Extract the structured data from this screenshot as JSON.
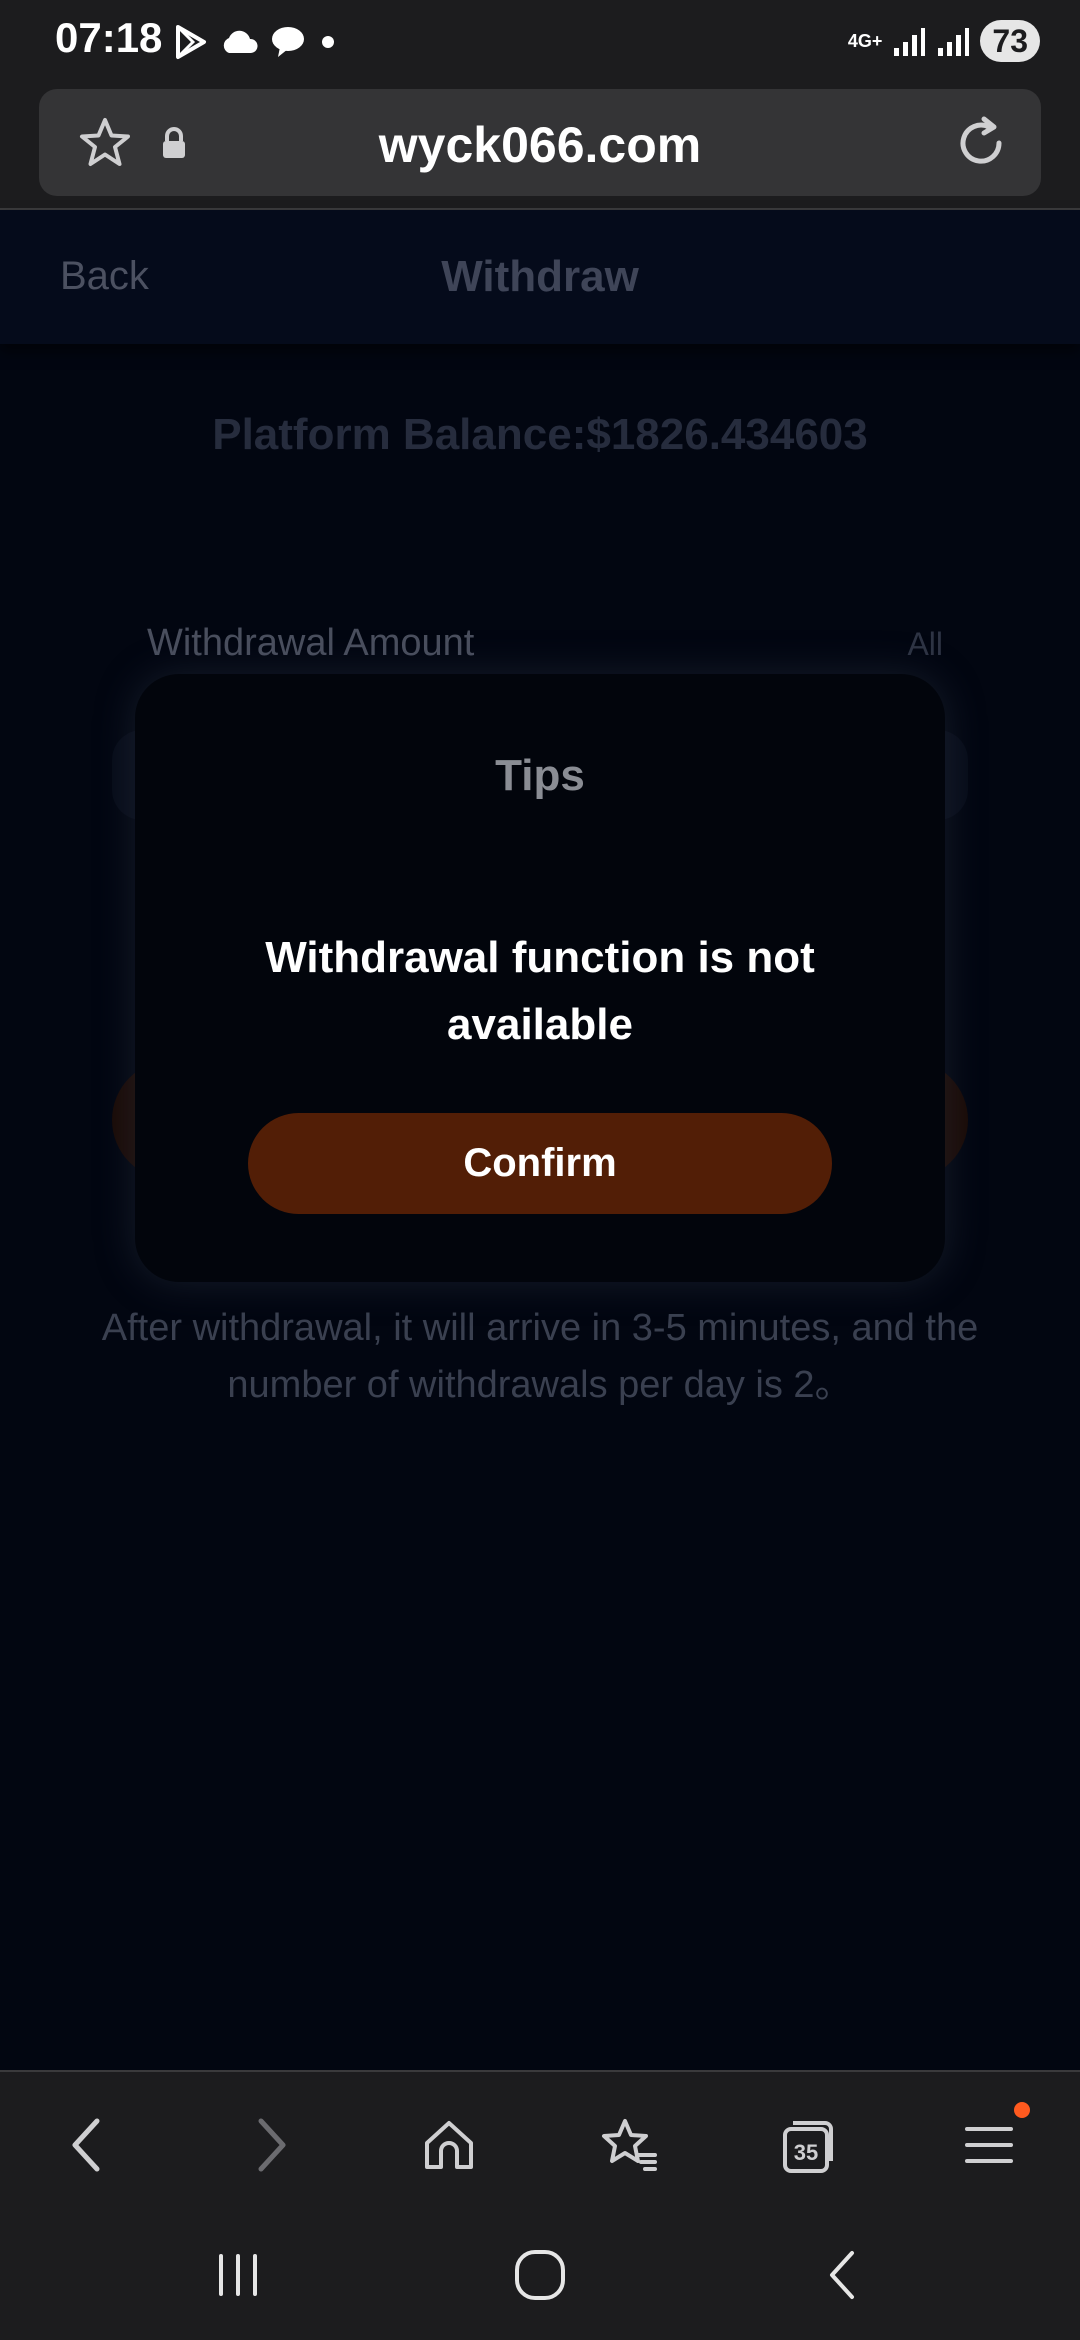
{
  "status_bar": {
    "time": "07:18",
    "network": "4G+",
    "battery": "73",
    "left_icons": [
      "play-store-icon",
      "cloud-icon",
      "chat-bubble-icon",
      "dot-icon"
    ]
  },
  "browser": {
    "url": "wyck066.com",
    "tab_count": "35"
  },
  "page": {
    "back_label": "Back",
    "title": "Withdraw",
    "balance_text": "Platform Balance:$1826.434603",
    "amount_label": "Withdrawal Amount",
    "all_label": "All",
    "note": "After withdrawal, it will arrive in 3-5 minutes, and the number of withdrawals per day is 2。"
  },
  "modal": {
    "title": "Tips",
    "message": "Withdrawal function is not available",
    "confirm_label": "Confirm"
  },
  "colors": {
    "page_bg": "#020611",
    "chrome_bg": "#1c1c1e",
    "confirm_button": "#521e06",
    "notification_dot": "#ff5a1f"
  }
}
